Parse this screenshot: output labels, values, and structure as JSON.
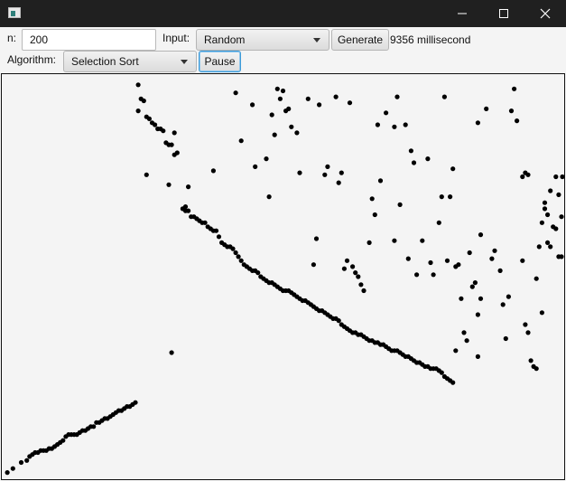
{
  "controls": {
    "n_label": "n:",
    "n_value": "200",
    "input_label": "Input:",
    "input_selected": "Random",
    "generate_label": "Generate",
    "timing_text": "9356 millisecond",
    "algorithm_label": "Algorithm:",
    "algorithm_selected": "Selection Sort",
    "pause_label": "Pause"
  },
  "icons": {
    "app": "app-icon",
    "minimize": "minimize-icon",
    "maximize": "maximize-icon",
    "close": "close-icon",
    "dropdown": "chevron-down-icon"
  },
  "colors": {
    "titlebar": "#202020",
    "background": "#f4f4f4",
    "point": "#000000",
    "focus": "#3c9ad8"
  },
  "chart_data": {
    "type": "scatter",
    "n": 200,
    "x_range": [
      0,
      200
    ],
    "y_range": [
      0,
      200
    ],
    "point_color": "#000000",
    "points": [
      [
        1,
        2
      ],
      [
        3,
        4
      ],
      [
        6,
        7
      ],
      [
        8,
        8
      ],
      [
        9,
        10
      ],
      [
        10,
        11
      ],
      [
        11,
        12
      ],
      [
        12,
        12
      ],
      [
        13,
        13
      ],
      [
        14,
        13
      ],
      [
        15,
        13
      ],
      [
        16,
        14
      ],
      [
        17,
        14
      ],
      [
        18,
        15
      ],
      [
        19,
        16
      ],
      [
        20,
        17
      ],
      [
        21,
        18
      ],
      [
        22,
        20
      ],
      [
        23,
        21
      ],
      [
        24,
        21
      ],
      [
        25,
        21
      ],
      [
        26,
        21
      ],
      [
        27,
        22
      ],
      [
        28,
        23
      ],
      [
        29,
        23
      ],
      [
        30,
        24
      ],
      [
        31,
        25
      ],
      [
        32,
        25
      ],
      [
        33,
        27
      ],
      [
        34,
        27
      ],
      [
        35,
        28
      ],
      [
        36,
        29
      ],
      [
        37,
        29
      ],
      [
        38,
        30
      ],
      [
        39,
        31
      ],
      [
        40,
        32
      ],
      [
        41,
        33
      ],
      [
        42,
        33
      ],
      [
        43,
        34
      ],
      [
        44,
        35
      ],
      [
        45,
        35
      ],
      [
        46,
        36
      ],
      [
        47,
        37
      ],
      [
        48,
        196
      ],
      [
        49,
        189
      ],
      [
        50,
        188
      ],
      [
        51,
        180
      ],
      [
        52,
        179
      ],
      [
        53,
        177
      ],
      [
        54,
        176
      ],
      [
        55,
        174
      ],
      [
        56,
        174
      ],
      [
        57,
        173
      ],
      [
        58,
        167
      ],
      [
        59,
        166
      ],
      [
        60,
        166
      ],
      [
        61,
        161
      ],
      [
        62,
        162
      ],
      [
        64,
        134
      ],
      [
        65,
        133
      ],
      [
        66,
        133
      ],
      [
        67,
        130
      ],
      [
        68,
        130
      ],
      [
        69,
        129
      ],
      [
        70,
        128
      ],
      [
        71,
        127
      ],
      [
        72,
        127
      ],
      [
        73,
        125
      ],
      [
        74,
        124
      ],
      [
        75,
        123
      ],
      [
        76,
        123
      ],
      [
        77,
        120
      ],
      [
        78,
        117
      ],
      [
        79,
        116
      ],
      [
        80,
        115
      ],
      [
        81,
        115
      ],
      [
        82,
        114
      ],
      [
        83,
        112
      ],
      [
        84,
        110
      ],
      [
        85,
        108
      ],
      [
        86,
        106
      ],
      [
        87,
        105
      ],
      [
        88,
        104
      ],
      [
        89,
        103
      ],
      [
        90,
        103
      ],
      [
        91,
        102
      ],
      [
        92,
        100
      ],
      [
        93,
        99
      ],
      [
        94,
        98
      ],
      [
        95,
        97
      ],
      [
        96,
        97
      ],
      [
        97,
        96
      ],
      [
        98,
        95
      ],
      [
        99,
        94
      ],
      [
        100,
        93
      ],
      [
        101,
        93
      ],
      [
        102,
        93
      ],
      [
        103,
        92
      ],
      [
        104,
        91
      ],
      [
        105,
        90
      ],
      [
        106,
        89
      ],
      [
        107,
        88
      ],
      [
        108,
        88
      ],
      [
        109,
        87
      ],
      [
        110,
        86
      ],
      [
        111,
        85
      ],
      [
        112,
        84
      ],
      [
        113,
        83
      ],
      [
        114,
        83
      ],
      [
        115,
        82
      ],
      [
        116,
        81
      ],
      [
        117,
        80
      ],
      [
        118,
        79
      ],
      [
        119,
        79
      ],
      [
        120,
        78
      ],
      [
        121,
        76
      ],
      [
        122,
        75
      ],
      [
        123,
        74
      ],
      [
        124,
        73
      ],
      [
        125,
        72
      ],
      [
        126,
        72
      ],
      [
        127,
        71
      ],
      [
        128,
        71
      ],
      [
        129,
        70
      ],
      [
        130,
        69
      ],
      [
        131,
        68
      ],
      [
        132,
        68
      ],
      [
        133,
        67
      ],
      [
        134,
        67
      ],
      [
        135,
        66
      ],
      [
        136,
        66
      ],
      [
        137,
        65
      ],
      [
        138,
        64
      ],
      [
        139,
        63
      ],
      [
        140,
        63
      ],
      [
        141,
        63
      ],
      [
        142,
        62
      ],
      [
        143,
        61
      ],
      [
        144,
        60
      ],
      [
        145,
        60
      ],
      [
        146,
        59
      ],
      [
        147,
        58
      ],
      [
        148,
        57
      ],
      [
        149,
        57
      ],
      [
        150,
        56
      ],
      [
        151,
        55
      ],
      [
        152,
        55
      ],
      [
        153,
        54
      ],
      [
        154,
        54
      ],
      [
        155,
        54
      ],
      [
        156,
        53
      ],
      [
        157,
        52
      ],
      [
        158,
        50
      ],
      [
        159,
        49
      ],
      [
        160,
        48
      ],
      [
        161,
        47
      ],
      [
        48,
        183
      ],
      [
        51,
        151
      ],
      [
        59,
        146
      ],
      [
        61,
        172
      ],
      [
        65,
        135
      ],
      [
        66,
        145
      ],
      [
        75,
        153
      ],
      [
        83,
        192
      ],
      [
        85,
        168
      ],
      [
        89,
        186
      ],
      [
        90,
        155
      ],
      [
        94,
        159
      ],
      [
        95,
        140
      ],
      [
        96,
        181
      ],
      [
        97,
        171
      ],
      [
        98,
        194
      ],
      [
        99,
        189
      ],
      [
        100,
        193
      ],
      [
        101,
        183
      ],
      [
        102,
        184
      ],
      [
        103,
        175
      ],
      [
        105,
        172
      ],
      [
        106,
        152
      ],
      [
        109,
        189
      ],
      [
        111,
        106
      ],
      [
        112,
        119
      ],
      [
        113,
        186
      ],
      [
        115,
        151
      ],
      [
        116,
        155
      ],
      [
        119,
        190
      ],
      [
        120,
        147
      ],
      [
        121,
        152
      ],
      [
        122,
        104
      ],
      [
        123,
        108
      ],
      [
        124,
        187
      ],
      [
        125,
        105
      ],
      [
        126,
        102
      ],
      [
        127,
        100
      ],
      [
        128,
        96
      ],
      [
        129,
        93
      ],
      [
        131,
        117
      ],
      [
        132,
        139
      ],
      [
        133,
        131
      ],
      [
        134,
        176
      ],
      [
        135,
        148
      ],
      [
        137,
        182
      ],
      [
        140,
        175
      ],
      [
        140,
        118
      ],
      [
        141,
        190
      ],
      [
        142,
        136
      ],
      [
        144,
        176
      ],
      [
        146,
        163
      ],
      [
        147,
        157
      ],
      [
        148,
        101
      ],
      [
        150,
        118
      ],
      [
        153,
        107
      ],
      [
        154,
        101
      ],
      [
        156,
        127
      ],
      [
        157,
        140
      ],
      [
        158,
        190
      ],
      [
        159,
        108
      ],
      [
        160,
        140
      ],
      [
        161,
        154
      ],
      [
        162,
        105
      ],
      [
        163,
        106
      ],
      [
        164,
        89
      ],
      [
        165,
        72
      ],
      [
        166,
        68
      ],
      [
        167,
        112
      ],
      [
        168,
        95
      ],
      [
        169,
        97
      ],
      [
        170,
        81
      ],
      [
        170,
        177
      ],
      [
        171,
        89
      ],
      [
        171,
        121
      ],
      [
        173,
        184
      ],
      [
        175,
        109
      ],
      [
        176,
        113
      ],
      [
        178,
        103
      ],
      [
        179,
        86
      ],
      [
        180,
        69
      ],
      [
        181,
        90
      ],
      [
        182,
        183
      ],
      [
        183,
        194
      ],
      [
        184,
        178
      ],
      [
        186,
        108
      ],
      [
        187,
        76
      ],
      [
        188,
        72
      ],
      [
        189,
        58
      ],
      [
        190,
        55
      ],
      [
        191,
        54
      ],
      [
        192,
        115
      ],
      [
        193,
        82
      ],
      [
        194,
        134
      ],
      [
        195,
        117
      ],
      [
        196,
        115
      ],
      [
        197,
        125
      ],
      [
        198,
        124
      ],
      [
        199,
        110
      ],
      [
        200,
        110
      ],
      [
        60,
        62
      ],
      [
        145,
        109
      ],
      [
        152,
        159
      ],
      [
        162,
        63
      ],
      [
        170,
        60
      ],
      [
        186,
        150
      ],
      [
        187,
        152
      ],
      [
        188,
        151
      ],
      [
        191,
        99
      ],
      [
        193,
        127
      ],
      [
        194,
        137
      ],
      [
        195,
        131
      ],
      [
        196,
        143
      ],
      [
        198,
        150
      ],
      [
        199,
        141
      ],
      [
        200,
        130
      ],
      [
        201,
        150
      ]
    ]
  }
}
